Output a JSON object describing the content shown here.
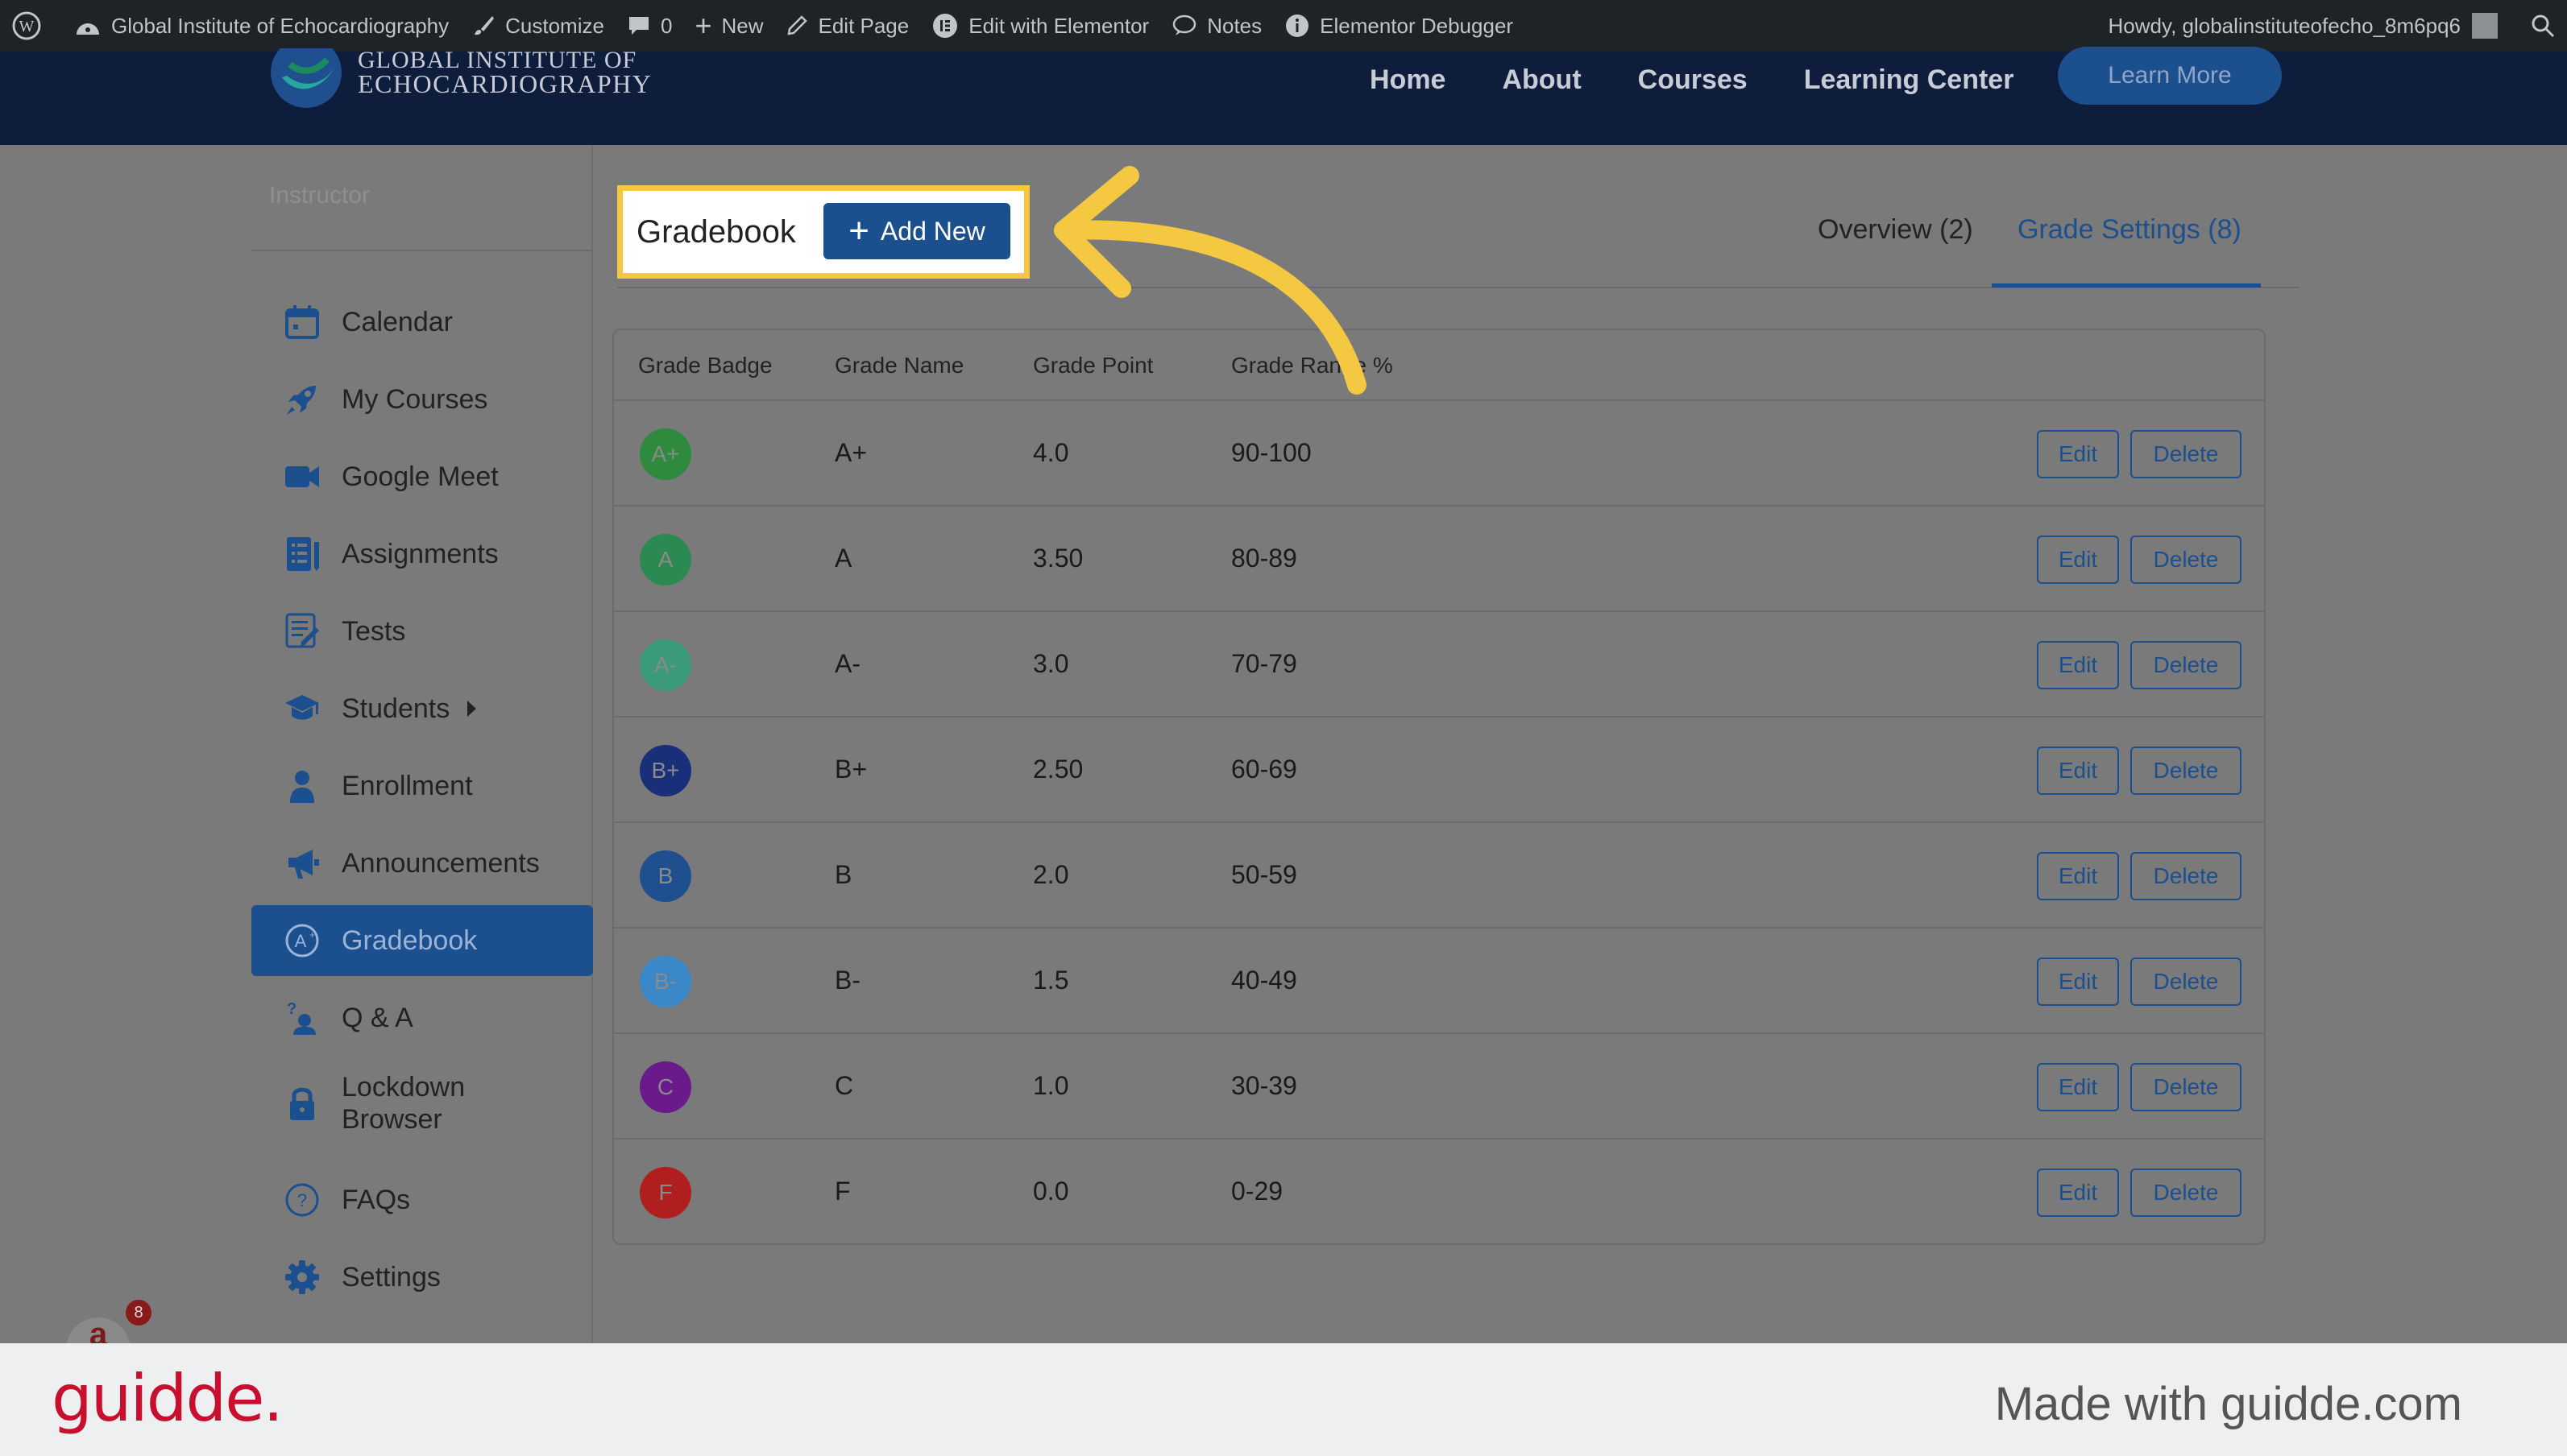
{
  "adminbar": {
    "site_name": "Global Institute of Echocardiography",
    "customize": "Customize",
    "comments_count": "0",
    "new": "New",
    "edit_page": "Edit Page",
    "edit_elementor": "Edit with Elementor",
    "notes": "Notes",
    "debugger": "Elementor Debugger",
    "howdy": "Howdy, globalinstituteofecho_8m6pq6"
  },
  "header": {
    "logo_line1": "GLOBAL INSTITUTE OF",
    "logo_line2": "ECHOCARDIOGRAPHY",
    "nav": [
      "Home",
      "About",
      "Courses",
      "Learning Center"
    ],
    "cta": "Learn More"
  },
  "sidebar": {
    "section_label": "Instructor",
    "items": [
      {
        "label": "Calendar",
        "icon": "calendar-icon"
      },
      {
        "label": "My Courses",
        "icon": "rocket-icon"
      },
      {
        "label": "Google Meet",
        "icon": "video-icon"
      },
      {
        "label": "Assignments",
        "icon": "assignment-icon"
      },
      {
        "label": "Tests",
        "icon": "test-icon"
      },
      {
        "label": "Students",
        "icon": "graduation-cap-icon"
      },
      {
        "label": "Enrollment",
        "icon": "user-icon"
      },
      {
        "label": "Announcements",
        "icon": "megaphone-icon"
      },
      {
        "label": "Gradebook",
        "icon": "gradebook-icon"
      },
      {
        "label": "Q & A",
        "icon": "qa-icon"
      },
      {
        "label": "Lockdown\nBrowser",
        "icon": "lock-icon"
      },
      {
        "label": "FAQs",
        "icon": "question-icon"
      },
      {
        "label": "Settings",
        "icon": "gear-icon"
      }
    ]
  },
  "main": {
    "title": "Gradebook",
    "add_new": "Add New",
    "tabs": [
      "Overview (2)",
      "Grade Settings (8)"
    ]
  },
  "table": {
    "headers": [
      "Grade Badge",
      "Grade Name",
      "Grade Point",
      "Grade Range %"
    ],
    "edit_label": "Edit",
    "delete_label": "Delete",
    "rows": [
      {
        "badge": "A+",
        "name": "A+",
        "point": "4.0",
        "range": "90-100",
        "color": "#2e8b3e"
      },
      {
        "badge": "A",
        "name": "A",
        "point": "3.50",
        "range": "80-89",
        "color": "#2a8a52"
      },
      {
        "badge": "A-",
        "name": "A-",
        "point": "3.0",
        "range": "70-79",
        "color": "#3a9a7a"
      },
      {
        "badge": "B+",
        "name": "B+",
        "point": "2.50",
        "range": "60-69",
        "color": "#1a2f7a"
      },
      {
        "badge": "B",
        "name": "B",
        "point": "2.0",
        "range": "50-59",
        "color": "#1f4f8f"
      },
      {
        "badge": "B-",
        "name": "B-",
        "point": "1.5",
        "range": "40-49",
        "color": "#3a88c8"
      },
      {
        "badge": "C",
        "name": "C",
        "point": "1.0",
        "range": "30-39",
        "color": "#6a1a8a"
      },
      {
        "badge": "F",
        "name": "F",
        "point": "0.0",
        "range": "0-29",
        "color": "#b01e1e"
      }
    ]
  },
  "help_badge_count": "8",
  "footer": {
    "logo": "guidde.",
    "made_with": "Made with guidde.com"
  },
  "colors": {
    "accent": "#1c4f8e",
    "highlight": "#f5c842",
    "brand_red": "#c8102e"
  }
}
